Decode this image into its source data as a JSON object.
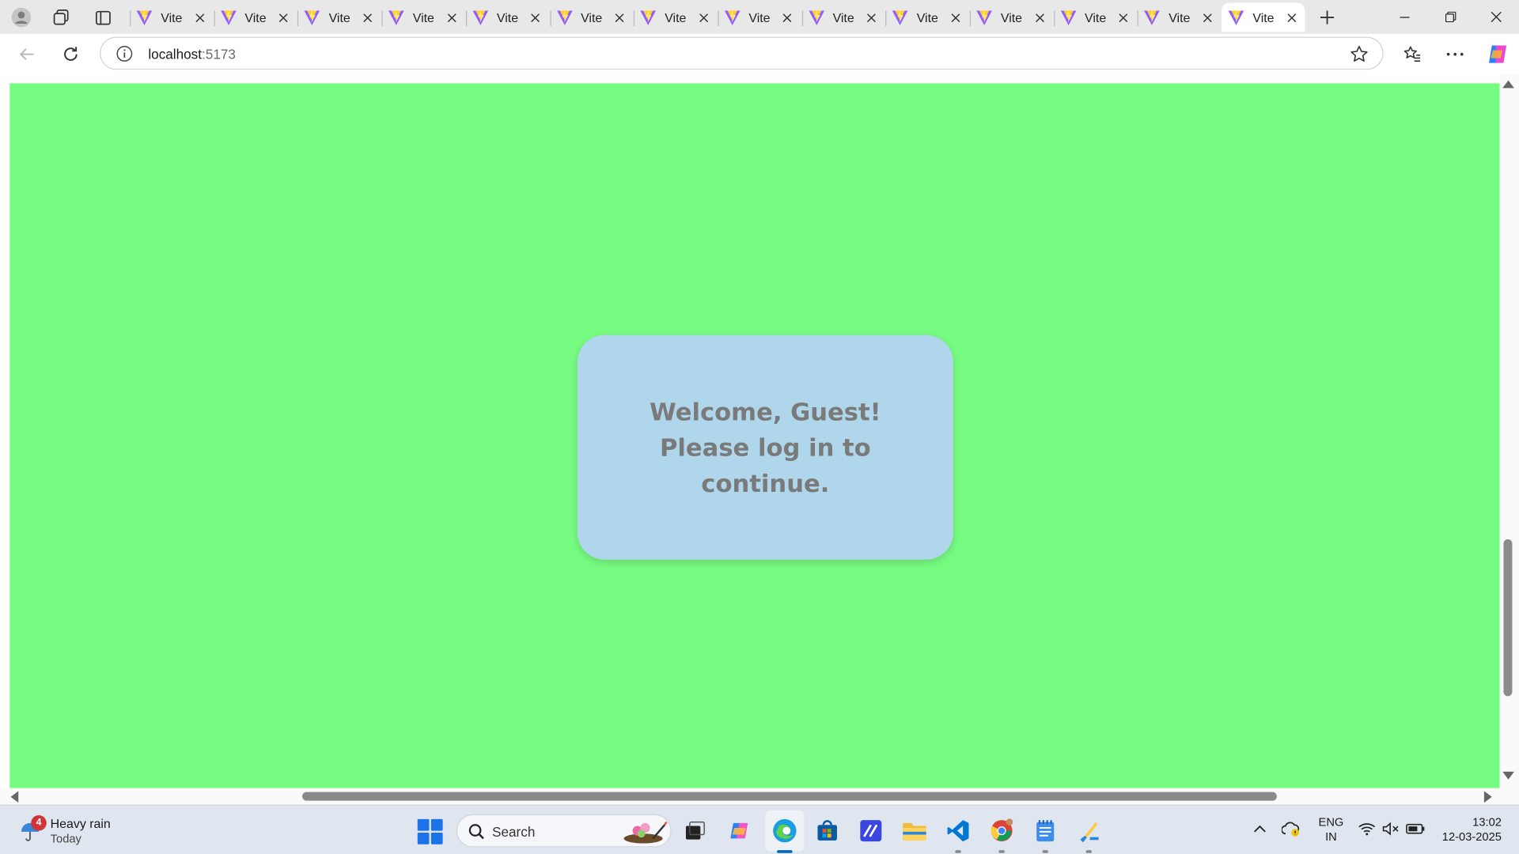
{
  "browser": {
    "tabs": [
      {
        "title": "Vite"
      },
      {
        "title": "Vite"
      },
      {
        "title": "Vite"
      },
      {
        "title": "Vite"
      },
      {
        "title": "Vite"
      },
      {
        "title": "Vite"
      },
      {
        "title": "Vite"
      },
      {
        "title": "Vite"
      },
      {
        "title": "Vite"
      },
      {
        "title": "Vite"
      },
      {
        "title": "Vite"
      },
      {
        "title": "Vite"
      },
      {
        "title": "Vite"
      },
      {
        "title": "Vite",
        "active": true
      }
    ],
    "address": {
      "host": "localhost",
      "port": ":5173"
    }
  },
  "page": {
    "background_color": "#77fc82",
    "card_color": "#afd6ea",
    "message": "Welcome, Guest! Please log in to continue."
  },
  "taskbar": {
    "weather": {
      "badge": "4",
      "condition": "Heavy rain",
      "day": "Today"
    },
    "search_label": "Search",
    "language": {
      "line1": "ENG",
      "line2": "IN"
    },
    "clock": {
      "time": "13:02",
      "date": "12-03-2025"
    }
  }
}
